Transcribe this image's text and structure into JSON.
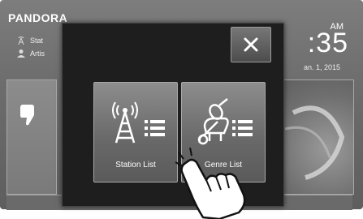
{
  "status_bar": {
    "app_name": "PANDORA",
    "station_text": "Stat",
    "artist_text": "Artis",
    "ampm": "AM",
    "time": ":35",
    "date": "an. 1, 2015"
  },
  "dialog": {
    "close_symbol": "✕",
    "options": [
      {
        "label": "Station List",
        "icon": "radio-tower-list-icon"
      },
      {
        "label": "Genre List",
        "icon": "instruments-list-icon"
      }
    ]
  },
  "colors": {
    "screen": "#6f6f6f",
    "dialog": "#1e1e1e",
    "tile": "#767676",
    "text": "#ffffff"
  }
}
